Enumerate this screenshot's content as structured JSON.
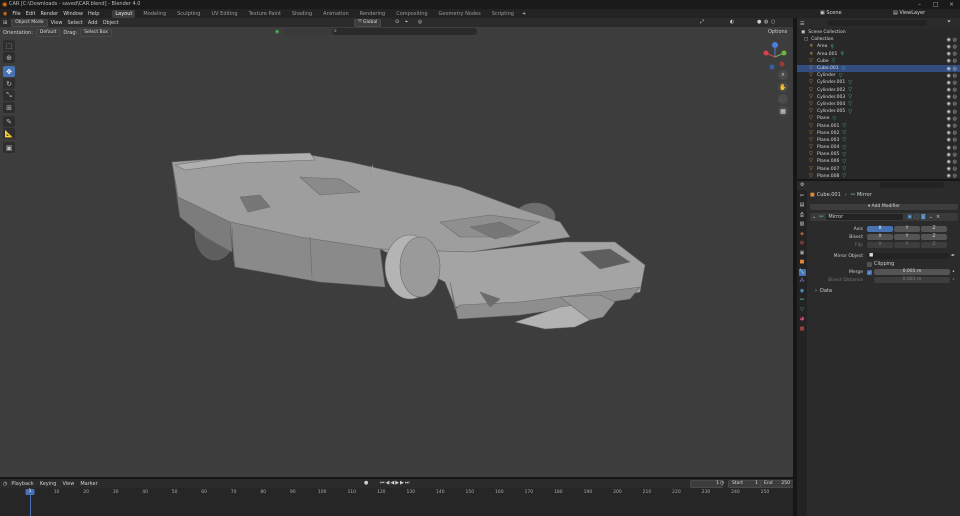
{
  "titlebar": {
    "title": "CAR [C:\\Downloads - saved\\CAR.blend] - Blender 4.0"
  },
  "menu": [
    "File",
    "Edit",
    "Render",
    "Window",
    "Help"
  ],
  "workspaces": [
    {
      "label": "Layout",
      "active": true
    },
    {
      "label": "Modeling"
    },
    {
      "label": "Sculpting"
    },
    {
      "label": "UV Editing"
    },
    {
      "label": "Texture Paint"
    },
    {
      "label": "Shading"
    },
    {
      "label": "Animation"
    },
    {
      "label": "Rendering"
    },
    {
      "label": "Compositing"
    },
    {
      "label": "Geometry Nodes"
    },
    {
      "label": "Scripting"
    }
  ],
  "scene": {
    "label": "Scene",
    "view_layer": "ViewLayer"
  },
  "toolbar": {
    "mode": "Object Mode",
    "view": "View",
    "select": "Select",
    "add": "Add",
    "object": "Object",
    "transform": "Global",
    "options": "Options"
  },
  "header2": {
    "orientation_label": "Orientation:",
    "orientation": "Default",
    "drag_label": "Drag:",
    "drag": "Select Box"
  },
  "timeline": {
    "playback": "Playback",
    "keying": "Keying",
    "view": "View",
    "marker": "Marker",
    "current": "1",
    "start_label": "Start",
    "start": "1",
    "end_label": "End",
    "end": "250",
    "ticks": [
      "1",
      "10",
      "20",
      "30",
      "40",
      "50",
      "60",
      "70",
      "80",
      "90",
      "100",
      "110",
      "120",
      "130",
      "140",
      "150",
      "160",
      "170",
      "180",
      "190",
      "200",
      "210",
      "220",
      "230",
      "240",
      "250"
    ]
  },
  "outliner": {
    "root": "Scene Collection",
    "collection": "Collection",
    "items": [
      "Area",
      "Area.001",
      "Cube",
      "Cube.001",
      "Cylinder",
      "Cylinder.001",
      "Cylinder.002",
      "Cylinder.003",
      "Cylinder.004",
      "Cylinder.005",
      "Plane",
      "Plane.001",
      "Plane.002",
      "Plane.003",
      "Plane.004",
      "Plane.005",
      "Plane.006",
      "Plane.007",
      "Plane.008"
    ]
  },
  "properties": {
    "object": "Cube.001",
    "modifier_crumb": "Mirror",
    "add_modifier": "Add Modifier",
    "modifier_name": "Mirror",
    "axis_label": "Axis",
    "bisect_label": "Bisect",
    "flip_label": "Flip",
    "x": "X",
    "y": "Y",
    "z": "Z",
    "mirror_object_label": "Mirror Object",
    "clipping_label": "Clipping",
    "merge_label": "Merge",
    "merge_value": "0.001 m",
    "bisect_distance_label": "Bisect Distance",
    "bisect_distance_value": "0.001 m",
    "data_label": "Data"
  },
  "colors": {
    "accent": "#4772b3",
    "viewport": "#3d3d3d",
    "object_orange": "#e59a3a",
    "mesh_teal": "#3fc2a6"
  }
}
